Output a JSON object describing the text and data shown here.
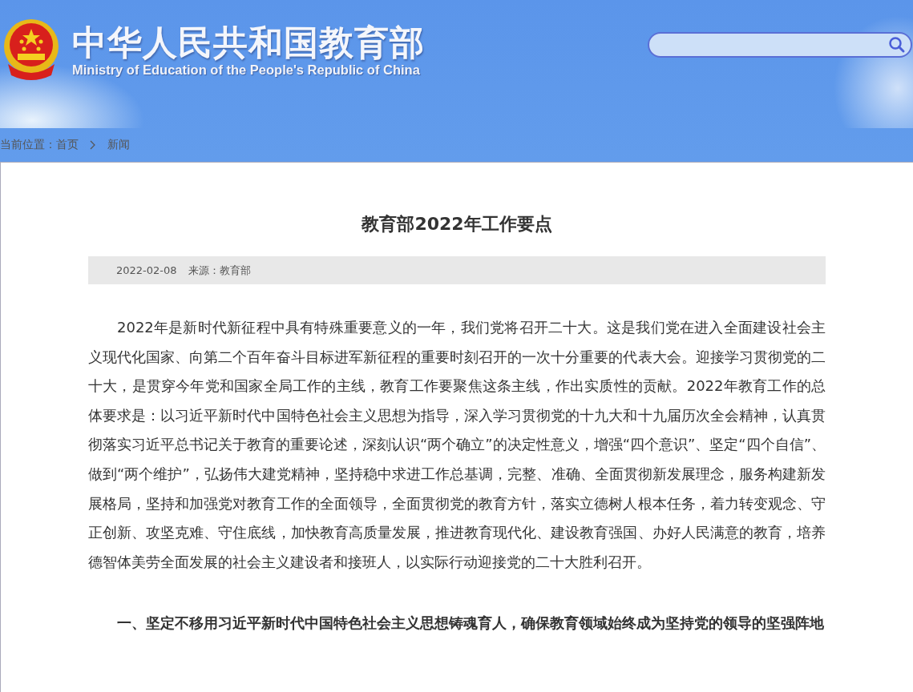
{
  "header": {
    "title": "中华人民共和国教育部",
    "subtitle": "Ministry of Education of the People's Republic of China"
  },
  "breadcrumb": {
    "label": "当前位置：",
    "items": [
      "首页",
      "新闻"
    ]
  },
  "article": {
    "title": "教育部2022年工作要点",
    "date": "2022-02-08",
    "source": "来源：教育部",
    "paragraphs": [
      {
        "kind": "body",
        "text": "2022年是新时代新征程中具有特殊重要意义的一年，我们党将召开二十大。这是我们党在进入全面建设社会主义现代化国家、向第二个百年奋斗目标进军新征程的重要时刻召开的一次十分重要的代表大会。迎接学习贯彻党的二十大，是贯穿今年党和国家全局工作的主线，教育工作要聚焦这条主线，作出实质性的贡献。2022年教育工作的总体要求是：以习近平新时代中国特色社会主义思想为指导，深入学习贯彻党的十九大和十九届历次全会精神，认真贯彻落实习近平总书记关于教育的重要论述，深刻认识“两个确立”的决定性意义，增强“四个意识”、坚定“四个自信”、做到“两个维护”，弘扬伟大建党精神，坚持稳中求进工作总基调，完整、准确、全面贯彻新发展理念，服务构建新发展格局，坚持和加强党对教育工作的全面领导，全面贯彻党的教育方针，落实立德树人根本任务，着力转变观念、守正创新、攻坚克难、守住底线，加快教育高质量发展，推进教育现代化、建设教育强国、办好人民满意的教育，培养德智体美劳全面发展的社会主义建设者和接班人，以实际行动迎接党的二十大胜利召开。"
      },
      {
        "kind": "heading",
        "text": "一、坚定不移用习近平新时代中国特色社会主义思想铸魂育人，确保教育领域始终成为坚持党的领导的坚强阵地"
      }
    ]
  }
}
